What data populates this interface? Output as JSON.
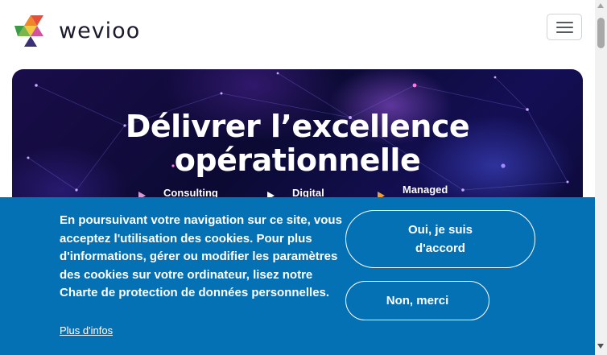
{
  "header": {
    "brand": "wevioo",
    "menu_icon": "hamburger-menu-icon"
  },
  "hero": {
    "title_line1": "Délivrer l’excellence",
    "title_line2": "opérationnelle",
    "links": [
      {
        "label": "Consulting",
        "icon": "triangle-bullet-icon"
      },
      {
        "label": "Digital",
        "icon": "triangle-bullet-icon"
      },
      {
        "label": "Managed",
        "icon": "triangle-bullet-icon"
      }
    ]
  },
  "cookie": {
    "message": "En poursuivant votre navigation sur ce site, vous acceptez l'utilisation des cookies. Pour plus d'informations, gérer ou modifier les paramètres des cookies sur votre ordinateur, lisez notre Charte de protection de données personnelles.",
    "more_link": "Plus d'infos",
    "accept_label": "Oui, je suis d'accord",
    "decline_label": "Non, merci"
  },
  "colors": {
    "cookie_bg": "#0571b5",
    "hero_bg": "#0b0a33",
    "bullet_pink": "#d99ad2",
    "bullet_white": "#ffffff",
    "bullet_orange": "#f0a030"
  }
}
